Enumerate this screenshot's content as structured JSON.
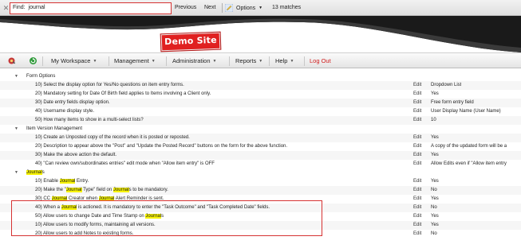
{
  "find_bar": {
    "close_glyph": "✕",
    "label": "Find:",
    "query": "journal",
    "previous_label": "Previous",
    "next_label": "Next",
    "options_label": "Options",
    "match_count": "13 matches"
  },
  "banner": {
    "badge_text": "Demo Site",
    "badge_color": "#e02020"
  },
  "nav": {
    "items": [
      {
        "label": "My Workspace"
      },
      {
        "label": "Management"
      },
      {
        "label": "Administration"
      },
      {
        "label": "Reports"
      },
      {
        "label": "Help"
      }
    ],
    "logout_label": "Log Out",
    "icons": [
      "tools-icon",
      "refresh-icon"
    ]
  },
  "colors": {
    "highlight": "#f7f300",
    "accent_red": "#d63232",
    "logout_red": "#d01c1c"
  },
  "settings": {
    "edit_label": "Edit",
    "groups": [
      {
        "title": "Form Options",
        "items": [
          {
            "text": "10) Select the display option for Yes/No questions on item entry forms.",
            "value": "Dropdown List"
          },
          {
            "text": "20) Mandatory setting for Date Of Birth field applies to Items involving a Client only.",
            "value": "Yes"
          },
          {
            "text": "30) Date entry fields display option.",
            "value": "Free form entry field"
          },
          {
            "text": "40) Username display style.",
            "value": "User Display Name (User Name)"
          },
          {
            "text": "50) How many items to show in a multi-select lists?",
            "value": "10"
          }
        ]
      },
      {
        "title": "Item Version Management",
        "items": [
          {
            "text": "10) Create an Unposted copy of the record when it is posted or reposted.",
            "value": "Yes"
          },
          {
            "text": "20) Description to appear above the \"Post\" and \"Update the Posted Record\" buttons on the form for the above function.",
            "value": "A copy of the updated form will be a"
          },
          {
            "text": "30) Make the above action the default.",
            "value": "Yes"
          },
          {
            "text": "40) \"Can review own/subordinates entries\" edit mode when \"Allow item entry\" is OFF",
            "value": "Allow Edits even if \"Allow item entry"
          }
        ]
      },
      {
        "title": "Journals",
        "items": [
          {
            "parts": [
              "10) Enable ",
              "Journal",
              " Entry."
            ],
            "value": "Yes"
          },
          {
            "parts": [
              "20) Make the \"",
              "Journal",
              " Type\" field on ",
              "Journal",
              "s to be mandatory."
            ],
            "value": "No"
          },
          {
            "parts": [
              "30) CC ",
              "Journal",
              " Creator when ",
              "Journal",
              " Alert Reminder is sent."
            ],
            "value": "Yes"
          },
          {
            "parts": [
              "40) When a ",
              "Journal",
              " is actioned. It is mandatory to enter the \"Task Outcome\" and \"Task Completed Date\" fields."
            ],
            "value": "No"
          },
          {
            "parts": [
              "50) Allow users to change Date and Time Stamp on ",
              "Journal",
              "s"
            ],
            "value": "Yes"
          }
        ]
      },
      {
        "title": "",
        "items": [
          {
            "text": "10) Allow users to modify forms, maintaining all versions.",
            "value": "Yes"
          },
          {
            "text": "20) Allow users to add Notes to existing forms.",
            "value": "No"
          }
        ]
      }
    ]
  }
}
